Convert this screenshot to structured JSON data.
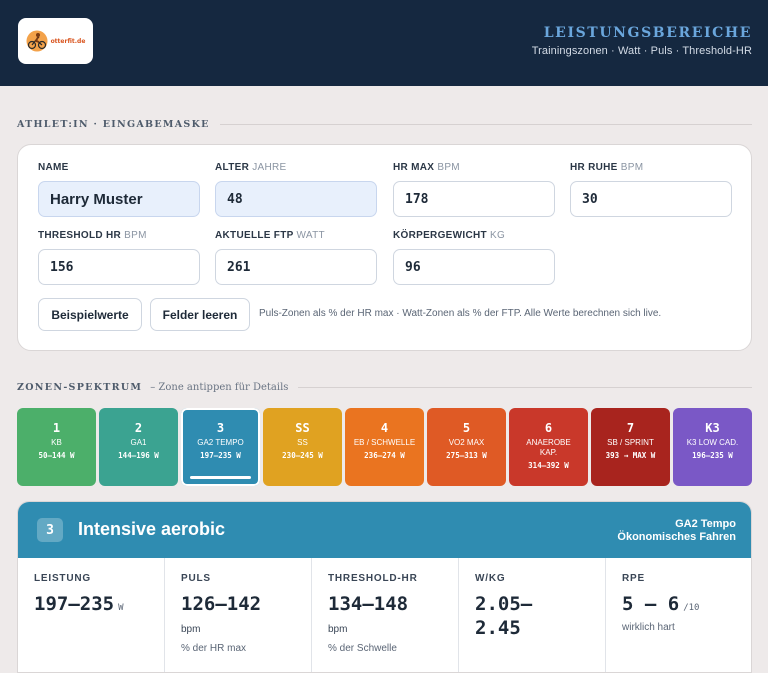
{
  "header": {
    "logo_text": "otterfit.de",
    "title": "LEISTUNGSBEREICHE",
    "subtitle": "Trainingszonen · Watt · Puls · Threshold-HR"
  },
  "form": {
    "section_title": "ATHLET:IN · EINGABEMASKE",
    "fields": [
      {
        "label": "NAME",
        "unit": "",
        "value": "Harry Muster"
      },
      {
        "label": "ALTER",
        "unit": "JAHRE",
        "value": "48"
      },
      {
        "label": "HR MAX",
        "unit": "BPM",
        "value": "178"
      },
      {
        "label": "HR RUHE",
        "unit": "BPM",
        "value": "30"
      },
      {
        "label": "THRESHOLD HR",
        "unit": "BPM",
        "value": "156"
      },
      {
        "label": "AKTUELLE FTP",
        "unit": "WATT",
        "value": "261"
      },
      {
        "label": "KÖRPERGEWICHT",
        "unit": "KG",
        "value": "96"
      }
    ],
    "btn_example": "Beispielwerte",
    "btn_clear": "Felder leeren",
    "hint": "Puls-Zonen als % der HR max · Watt-Zonen als % der FTP. Alle Werte berechnen sich live."
  },
  "spectrum": {
    "section_title": "ZONEN-SPEKTRUM",
    "section_desc": "– Zone antippen für Details",
    "zones": [
      {
        "num": "1",
        "label": "KB",
        "watts": "50–144 W",
        "color": "#4caf6a"
      },
      {
        "num": "2",
        "label": "GA1",
        "watts": "144–196 W",
        "color": "#3ba391"
      },
      {
        "num": "3",
        "label": "GA2 TEMPO",
        "watts": "197–235 W",
        "color": "#2f8cb1"
      },
      {
        "num": "SS",
        "label": "SS",
        "watts": "230–245 W",
        "color": "#e0a221"
      },
      {
        "num": "4",
        "label": "EB / SCHWELLE",
        "watts": "236–274 W",
        "color": "#ea7420"
      },
      {
        "num": "5",
        "label": "VO2 MAX",
        "watts": "275–313 W",
        "color": "#df5a25"
      },
      {
        "num": "6",
        "label": "ANAEROBE KAP.",
        "watts": "314–392 W",
        "color": "#c9382a"
      },
      {
        "num": "7",
        "label": "SB / SPRINT",
        "watts": "393 → MAX W",
        "color": "#a8241e"
      },
      {
        "num": "K3",
        "label": "K3 LOW CAD.",
        "watts": "196–235 W",
        "color": "#7a58c6"
      }
    ]
  },
  "detail": {
    "num": "3",
    "title": "Intensive aerobic",
    "right_line1": "GA2 Tempo",
    "right_line2": "Ökonomisches Fahren",
    "metrics": {
      "leistung": {
        "label": "LEISTUNG",
        "value": "197–235",
        "unit": "W"
      },
      "puls": {
        "label": "PULS",
        "value": "126–142",
        "unit": "bpm",
        "note": "% der HR max"
      },
      "threshold": {
        "label": "THRESHOLD-HR",
        "value": "134–148",
        "unit": "bpm",
        "note": "% der Schwelle"
      },
      "wkg": {
        "label": "W/KG",
        "value_line1": "2.05–",
        "value_line2": "2.45"
      },
      "rpe": {
        "label": "RPE",
        "value": "5 – 6",
        "unit": "/10",
        "note": "wirklich hart"
      }
    }
  }
}
